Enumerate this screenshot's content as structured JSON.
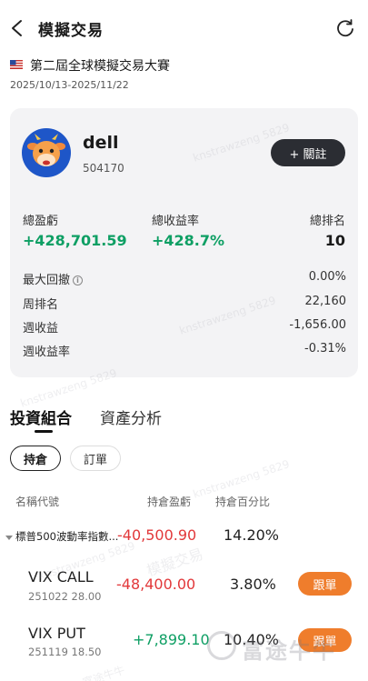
{
  "header": {
    "title": "模擬交易"
  },
  "contest": {
    "name": "第二屆全球模擬交易大賽",
    "dates": "2025/10/13-2025/11/22"
  },
  "profile": {
    "username": "dell",
    "user_id": "504170",
    "follow_label": "+ 關註"
  },
  "stats": {
    "total_pnl_label": "總盈虧",
    "total_pnl_value": "+428,701.59",
    "total_return_label": "總收益率",
    "total_return_value": "+428.7%",
    "total_rank_label": "總排名",
    "total_rank_value": "10"
  },
  "metrics": [
    {
      "label": "最大回撤",
      "value": "0.00%"
    },
    {
      "label": "周排名",
      "value": "22,160"
    },
    {
      "label": "週收益",
      "value": "-1,656.00"
    },
    {
      "label": "週收益率",
      "value": "-0.31%"
    }
  ],
  "tabs": [
    {
      "label": "投資組合"
    },
    {
      "label": "資產分析"
    }
  ],
  "subtabs": [
    {
      "label": "持倉"
    },
    {
      "label": "訂單"
    }
  ],
  "columns": {
    "name": "名稱代號",
    "pnl": "持倉盈虧",
    "pct": "持倉百分比"
  },
  "positions": [
    {
      "name": "標普500波動率指數...",
      "sub": "",
      "pnl": "-40,500.90",
      "pct": "14.20%",
      "action": ""
    },
    {
      "name": "VIX CALL",
      "sub": "251022 28.00",
      "pnl": "-48,400.00",
      "pct": "3.80%",
      "action": "跟單"
    },
    {
      "name": "VIX PUT",
      "sub": "251119 18.50",
      "pnl": "+7,899.10",
      "pct": "10.40%",
      "action": "跟單"
    }
  ],
  "watermark": {
    "text": "knstrawzeng 5829",
    "brand": "富途牛牛",
    "secondary": "模擬交易"
  },
  "colors": {
    "gain": "#0e9f64",
    "loss": "#e2383a",
    "accent": "#ef7d2c",
    "dark_button": "#2b2d33"
  }
}
